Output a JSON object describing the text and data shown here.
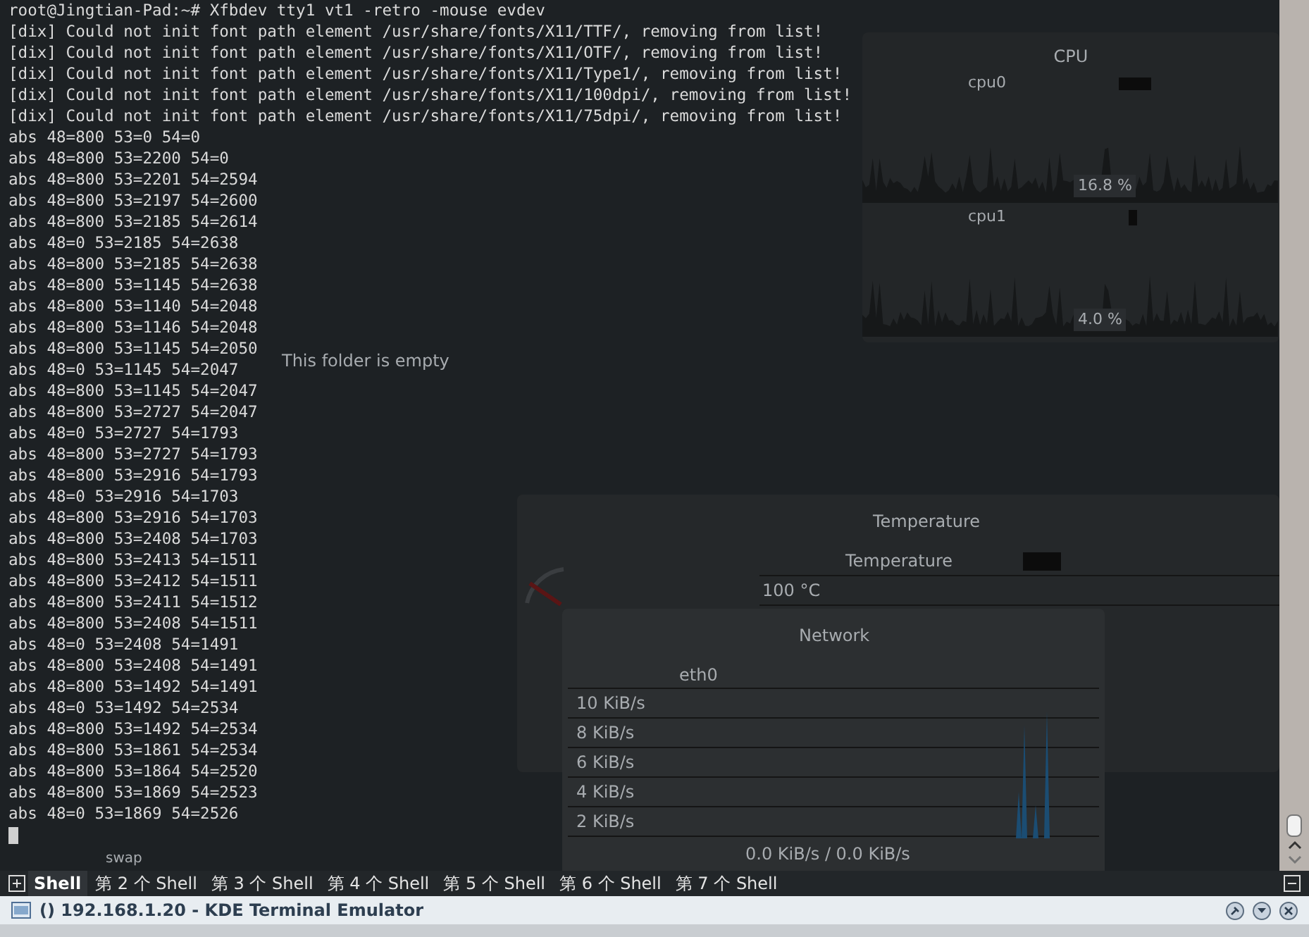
{
  "terminal": {
    "lines": [
      "root@Jingtian-Pad:~# Xfbdev tty1 vt1 -retro -mouse evdev",
      "[dix] Could not init font path element /usr/share/fonts/X11/TTF/, removing from list!",
      "[dix] Could not init font path element /usr/share/fonts/X11/OTF/, removing from list!",
      "[dix] Could not init font path element /usr/share/fonts/X11/Type1/, removing from list!",
      "[dix] Could not init font path element /usr/share/fonts/X11/100dpi/, removing from list!",
      "[dix] Could not init font path element /usr/share/fonts/X11/75dpi/, removing from list!",
      "abs 48=800 53=0 54=0",
      "abs 48=800 53=2200 54=0",
      "abs 48=800 53=2201 54=2594",
      "abs 48=800 53=2197 54=2600",
      "abs 48=800 53=2185 54=2614",
      "abs 48=0 53=2185 54=2638",
      "abs 48=800 53=2185 54=2638",
      "abs 48=800 53=1145 54=2638",
      "abs 48=800 53=1140 54=2048",
      "abs 48=800 53=1146 54=2048",
      "abs 48=800 53=1145 54=2050",
      "abs 48=0 53=1145 54=2047",
      "abs 48=800 53=1145 54=2047",
      "abs 48=800 53=2727 54=2047",
      "abs 48=0 53=2727 54=1793",
      "abs 48=800 53=2727 54=1793",
      "abs 48=800 53=2916 54=1793",
      "abs 48=0 53=2916 54=1703",
      "abs 48=800 53=2916 54=1703",
      "abs 48=800 53=2408 54=1703",
      "abs 48=800 53=2413 54=1511",
      "abs 48=800 53=2412 54=1511",
      "abs 48=800 53=2411 54=1512",
      "abs 48=800 53=2408 54=1511",
      "abs 48=0 53=2408 54=1491",
      "abs 48=800 53=2408 54=1491",
      "abs 48=800 53=1492 54=1491",
      "abs 48=0 53=1492 54=2534",
      "abs 48=800 53=1492 54=2534",
      "abs 48=800 53=1861 54=2534",
      "abs 48=800 53=1864 54=2520",
      "abs 48=800 53=1869 54=2523",
      "abs 48=0 53=1869 54=2526"
    ]
  },
  "desktop": {
    "folder_view": {
      "message": "This folder is empty"
    },
    "memory": {
      "label": "swap"
    },
    "cpu": {
      "title": "CPU",
      "cores": [
        {
          "name": "cpu0",
          "reading": "16.8 %"
        },
        {
          "name": "cpu1",
          "reading": "4.0 %"
        }
      ]
    },
    "temperature": {
      "title": "Temperature",
      "legend": "Temperature",
      "top_label": "100 °C"
    },
    "network": {
      "title": "Network",
      "interface": "eth0",
      "scale": [
        "10 KiB/s",
        "8 KiB/s",
        "6 KiB/s",
        "4 KiB/s",
        "2 KiB/s"
      ],
      "reading": "0.0 KiB/s / 0.0 KiB/s"
    }
  },
  "tabs": [
    {
      "label": "Shell",
      "selected": true
    },
    {
      "label": "第 2 个 Shell",
      "selected": false
    },
    {
      "label": "第 3 个 Shell",
      "selected": false
    },
    {
      "label": "第 4 个 Shell",
      "selected": false
    },
    {
      "label": "第 5 个 Shell",
      "selected": false
    },
    {
      "label": "第 6 个 Shell",
      "selected": false
    },
    {
      "label": "第 7 个 Shell",
      "selected": false
    }
  ],
  "window": {
    "title": "() 192.168.1.20 - KDE Terminal Emulator"
  }
}
